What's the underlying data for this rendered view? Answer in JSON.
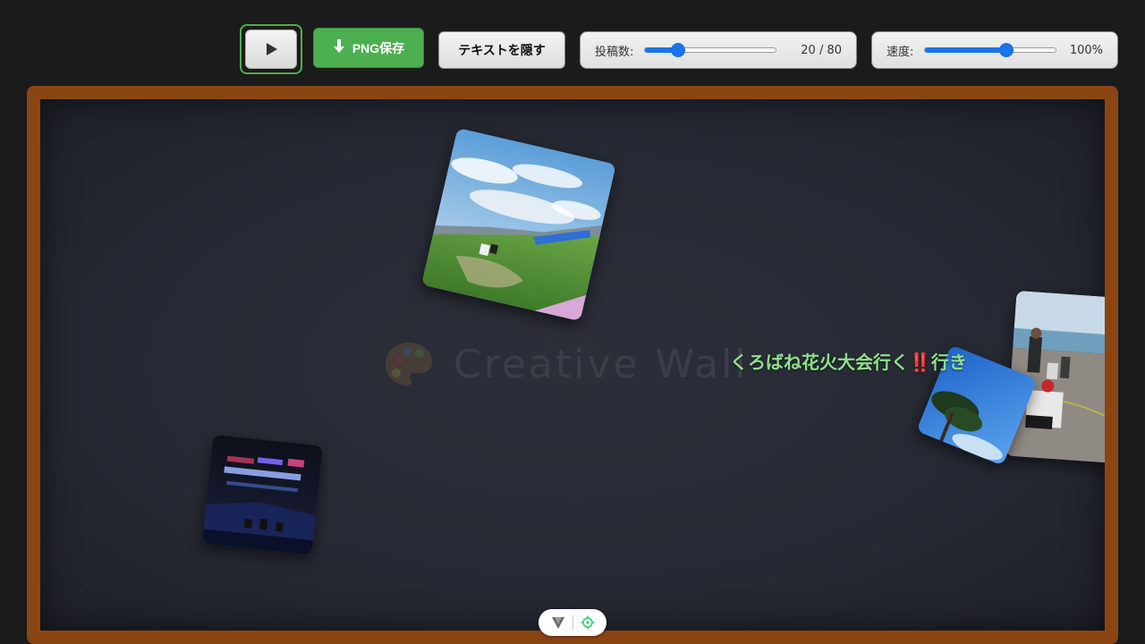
{
  "toolbar": {
    "play_icon": "play-icon",
    "download_label": "PNG保存",
    "download_icon": "download-arrow-icon",
    "hide_text_label": "テキストを隠す",
    "post_count": {
      "label": "投稿数:",
      "current": 20,
      "max": 80,
      "display": "20 / 80",
      "fraction": 0.25
    },
    "speed": {
      "label": "速度:",
      "display": "100%",
      "fraction": 0.625
    },
    "accent_color": "#4caf50",
    "slider_color": "#1a73e8"
  },
  "wall": {
    "frame_color": "#8b4513",
    "watermark_icon": "palette-icon",
    "watermark_text": "Creative Wall",
    "posts": [
      {
        "type": "text",
        "text": "くろばね花火大会行く‼️行き",
        "color": "#8fe08c"
      },
      {
        "type": "image",
        "subject": "grass-field-sky-photo"
      },
      {
        "type": "image",
        "subject": "night-drone-show-photo"
      },
      {
        "type": "image",
        "subject": "beach-people-photo"
      },
      {
        "type": "image",
        "subject": "tree-blue-sky-photo"
      }
    ]
  },
  "bottom_bar": {
    "icons": [
      "vuetify-logo-icon",
      "target-icon"
    ]
  }
}
